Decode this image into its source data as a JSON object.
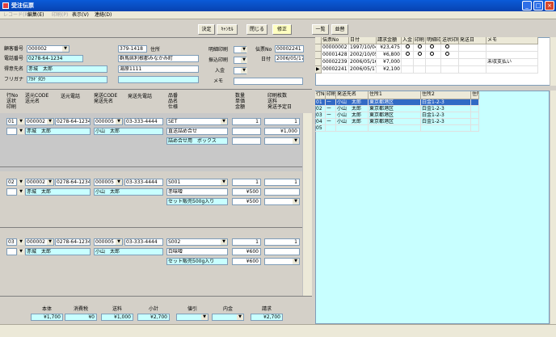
{
  "window": {
    "title": "受注伝票"
  },
  "menu": [
    "レコード(R)",
    "編集(E)",
    "印刷(P)",
    "表示(V)",
    "連絡(D)"
  ],
  "toolbar": {
    "decide": "決定",
    "cancel": "ｷｬﾝｾﾙ",
    "close": "閉じる",
    "fix": "修正",
    "list": "一覧",
    "order": "並替"
  },
  "customer": {
    "code_label": "顧客番号",
    "code": "000002",
    "tel_label": "電話番号",
    "tel": "0278-64-1234",
    "name_label": "得意先名",
    "name": "赤城　太郎",
    "kana_label": "フリガナ",
    "kana": "ｱｶｷﾞﾀﾛｳ",
    "zip": "379-1418",
    "addr_label": "住所",
    "addr1": "群馬県利根郡みなかみ町",
    "addr2": "湯原1111"
  },
  "order": {
    "detail_print_label": "明細印刷",
    "delivery_print_label": "振込印刷",
    "payment_label": "入金",
    "memo_label": "メモ",
    "slip_no_label": "伝票No",
    "slip_no": "00002241",
    "date_label": "日付",
    "date": "2006/05/17"
  },
  "head": {
    "col1": [
      "行No",
      "送状",
      "印刷"
    ],
    "cust": [
      "送元CODE",
      "送元名"
    ],
    "tel": "送元電話",
    "dest": [
      "発送CODE",
      "発送先名"
    ],
    "dtel": "発送先電話",
    "item": [
      "品番",
      "品名",
      "仕様"
    ],
    "qty": [
      "数量",
      "単価",
      "金額"
    ],
    "ship": [
      "印刷枚数",
      "送料",
      "発送予定日"
    ]
  },
  "lines": [
    {
      "no": "01",
      "code": "000002",
      "tel": "0278-64-1234",
      "name": "赤城　太郎",
      "dcode": "000005",
      "dtel": "03-333-4444",
      "dname": "小山　太郎",
      "item": "SET",
      "iname": "直送詰め合せ",
      "ispec": "詰め合せ用　ボックス",
      "qty": "1",
      "price": "",
      "amount": "",
      "count": "1",
      "fee": "¥1,000"
    },
    {
      "no": "02",
      "code": "000002",
      "tel": "0278-64-1234",
      "name": "赤城　太郎",
      "dcode": "000005",
      "dtel": "03-333-4444",
      "dname": "小山　太郎",
      "item": "S001",
      "iname": "赤味噌",
      "ispec": "セット販売500g入り",
      "qty": "1",
      "price": "¥500",
      "amount": "¥500",
      "count": "1",
      "fee": ""
    },
    {
      "no": "03",
      "code": "000002",
      "tel": "0278-64-1234",
      "name": "赤城　太郎",
      "dcode": "000005",
      "dtel": "03-333-4444",
      "dname": "小山　太郎",
      "item": "S002",
      "iname": "白味噌",
      "ispec": "セット販売500g入り",
      "qty": "1",
      "price": "¥600",
      "amount": "¥600",
      "count": "1",
      "fee": ""
    }
  ],
  "totals": {
    "labels": [
      "本体",
      "消費税",
      "送料",
      "小計",
      "値引",
      "内金",
      "請求"
    ],
    "values": [
      "¥1,700",
      "¥0",
      "¥1,000",
      "¥2,700",
      "",
      "",
      "¥2,700"
    ]
  },
  "slip_grid": {
    "headers": [
      "伝票No",
      "日付",
      "請求金額",
      "入金",
      "印刷",
      "明細印刷",
      "送状印刷",
      "発送日",
      "メモ"
    ],
    "rows": [
      [
        "00000002",
        "1997/10/04",
        "¥23,475",
        "o",
        "o",
        "o",
        "o",
        "",
        ""
      ],
      [
        "00001428",
        "2002/10/05",
        "¥6,800",
        "o",
        "o",
        "o",
        "o",
        "",
        ""
      ],
      [
        "00002239",
        "2006/05/16",
        "¥7,000",
        "",
        "",
        "",
        "",
        "",
        "未収支払い"
      ],
      [
        "00002241",
        "2006/05/17",
        "¥2,100",
        "",
        "",
        "",
        "",
        "",
        ""
      ]
    ]
  },
  "dest_grid": {
    "headers": [
      "行No",
      "印刷",
      "発送先名",
      "住所1",
      "住所2",
      "住所"
    ],
    "rows": [
      [
        "01",
        "ー",
        "小山　太郎",
        "東京都港区",
        "白金1-2-3",
        ""
      ],
      [
        "02",
        "ー",
        "小山　太郎",
        "東京都港区",
        "白金1-2-3",
        ""
      ],
      [
        "03",
        "ー",
        "小山　太郎",
        "東京都港区",
        "白金1-2-3",
        ""
      ],
      [
        "04",
        "ー",
        "小山　太郎",
        "東京都港区",
        "白金1-2-3",
        ""
      ],
      [
        "05",
        "",
        "",
        "",
        "",
        ""
      ]
    ]
  },
  "colors": {
    "title": "#0a5bd8",
    "cyan": "#c8ffff",
    "select": "#316ac5",
    "panel_gray": "#c8c8c8"
  }
}
